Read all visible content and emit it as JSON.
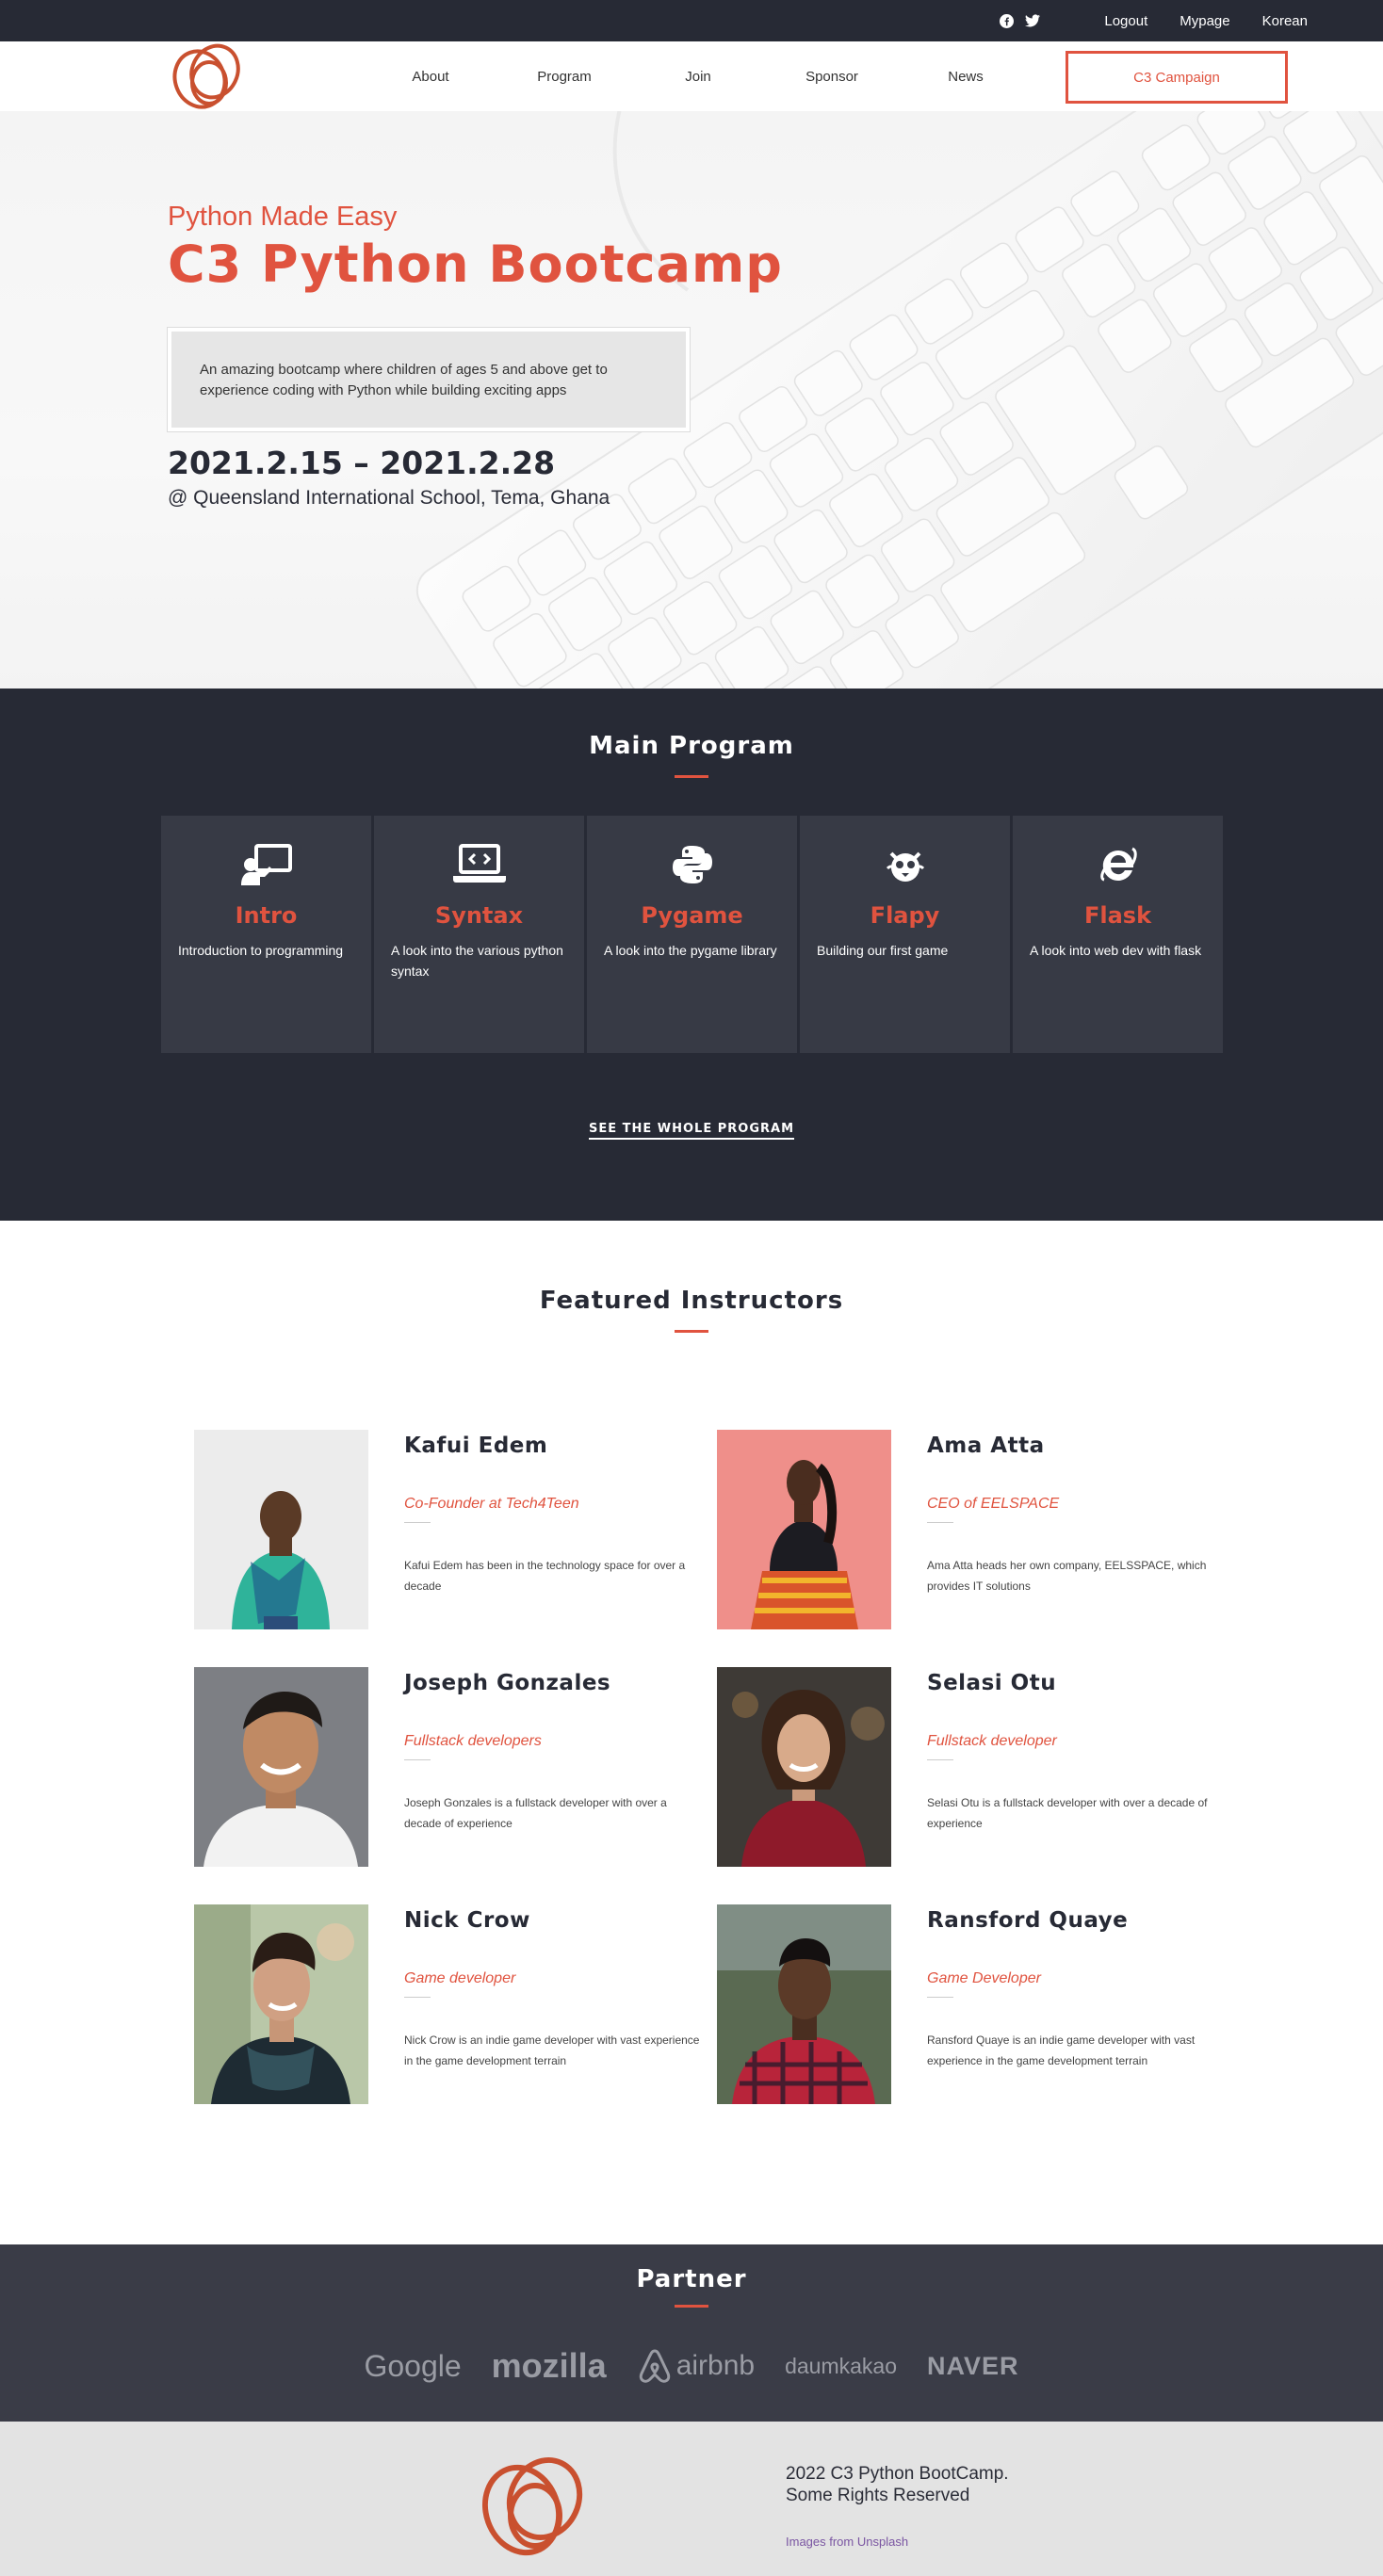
{
  "topbar": {
    "icons": [
      "facebook-icon",
      "twitter-icon"
    ],
    "links": [
      "Logout",
      "Mypage",
      "Korean"
    ]
  },
  "nav": {
    "items": [
      "About",
      "Program",
      "Join",
      "Sponsor",
      "News"
    ],
    "cta": "C3 Campaign"
  },
  "hero": {
    "kicker": "Python Made Easy",
    "title": "C3 Python Bootcamp",
    "blurb": "An amazing bootcamp where children of ages 5 and above get to experience coding with Python while building exciting apps",
    "dates": "2021.2.15 – 2021.2.28",
    "place": "@ Queensland International School, Tema, Ghana"
  },
  "program": {
    "title": "Main Program",
    "cards": [
      {
        "icon": "teacher-board-icon",
        "title": "Intro",
        "text": "Introduction to programming"
      },
      {
        "icon": "laptop-code-icon",
        "title": "Syntax",
        "text": "A look into the various python syntax"
      },
      {
        "icon": "python-logo-icon",
        "title": "Pygame",
        "text": "A look into the pygame library"
      },
      {
        "icon": "flappy-bird-icon",
        "title": "Flapy",
        "text": "Building our first game"
      },
      {
        "icon": "web-browser-icon",
        "title": "Flask",
        "text": "A look into web dev with flask"
      }
    ],
    "more": "SEE THE WHOLE PROGRAM"
  },
  "instructors": {
    "title": "Featured Instructors",
    "people": [
      {
        "name": "Kafui Edem",
        "role": "Co-Founder at Tech4Teen",
        "bio": "Kafui Edem has been in the technology space for over a decade"
      },
      {
        "name": "Ama Atta",
        "role": "CEO of EELSPACE",
        "bio": "Ama Atta heads her own company, EELSSPACE, which provides IT solutions"
      },
      {
        "name": "Joseph Gonzales",
        "role": "Fullstack developers",
        "bio": "Joseph Gonzales is a fullstack developer with over a decade of experience"
      },
      {
        "name": "Selasi Otu",
        "role": "Fullstack developer",
        "bio": "Selasi Otu is a fullstack developer with over a decade of experience"
      },
      {
        "name": "Nick Crow",
        "role": "Game developer",
        "bio": "Nick Crow is an indie game developer with vast experience in the game development terrain"
      },
      {
        "name": "Ransford Quaye",
        "role": "Game Developer",
        "bio": "Ransford Quaye is an indie game developer with vast experience in the game development terrain"
      }
    ]
  },
  "partner": {
    "title": "Partner",
    "logos": [
      "Google",
      "mozilla",
      "airbnb",
      "daumkakao",
      "NAVER"
    ]
  },
  "footer": {
    "copyright_line1": "2022 C3 Python BootCamp.",
    "copyright_line2": "Some Rights Reserved",
    "credit": "Images from Unsplash"
  },
  "colors": {
    "accent": "#e0533f",
    "dark": "#272a35",
    "card": "#373a45",
    "partner_bg": "#3a3c47",
    "footer_bg": "#e3e3e3"
  }
}
